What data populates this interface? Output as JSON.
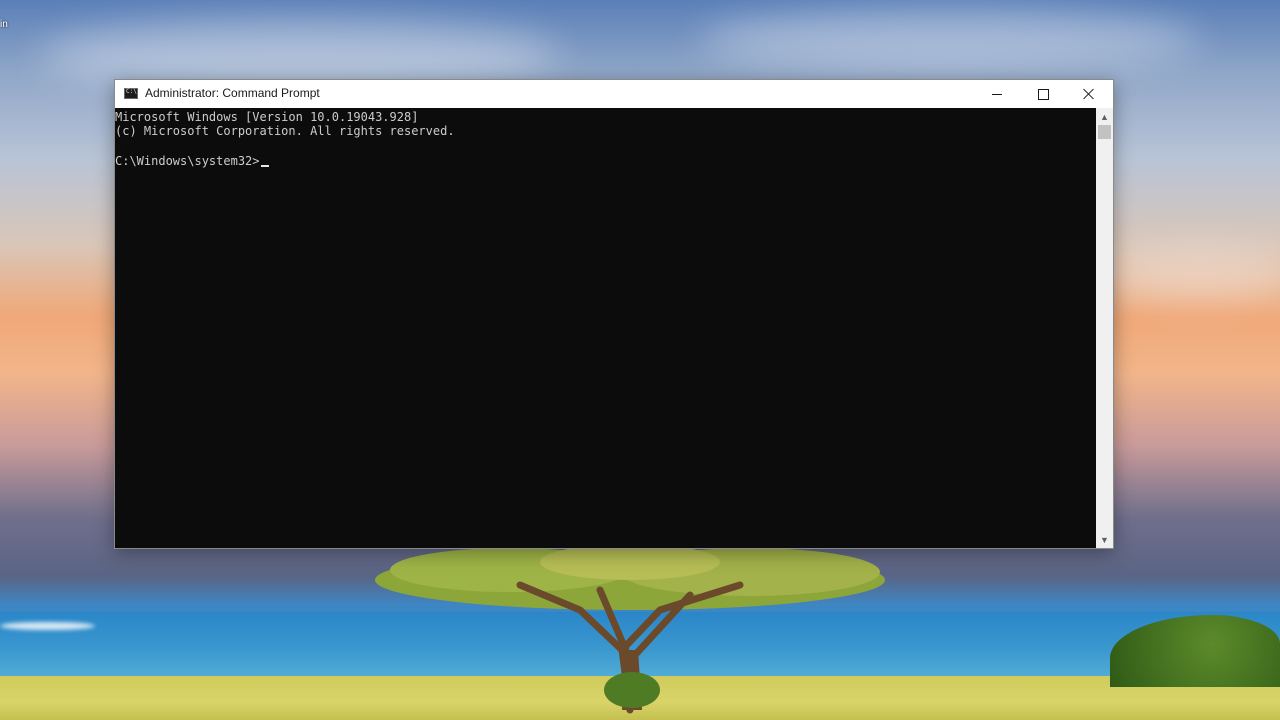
{
  "desktop": {
    "icon_label_fragment": "in"
  },
  "window": {
    "title": "Administrator: Command Prompt",
    "buttons": {
      "minimize": "minimize",
      "maximize": "maximize",
      "close": "close"
    }
  },
  "console": {
    "lines": [
      "Microsoft Windows [Version 10.0.19043.928]",
      "(c) Microsoft Corporation. All rights reserved.",
      "C:\\Windows\\system32>"
    ]
  },
  "icons": {
    "app": "cmd-icon",
    "minimize": "minimize-icon",
    "maximize": "maximize-icon",
    "close": "close-icon",
    "scroll_up": "chevron-up-icon",
    "scroll_down": "chevron-down-icon"
  },
  "colors": {
    "console_bg": "#0c0c0c",
    "console_text": "#cccccc",
    "titlebar_bg": "#ffffff"
  }
}
